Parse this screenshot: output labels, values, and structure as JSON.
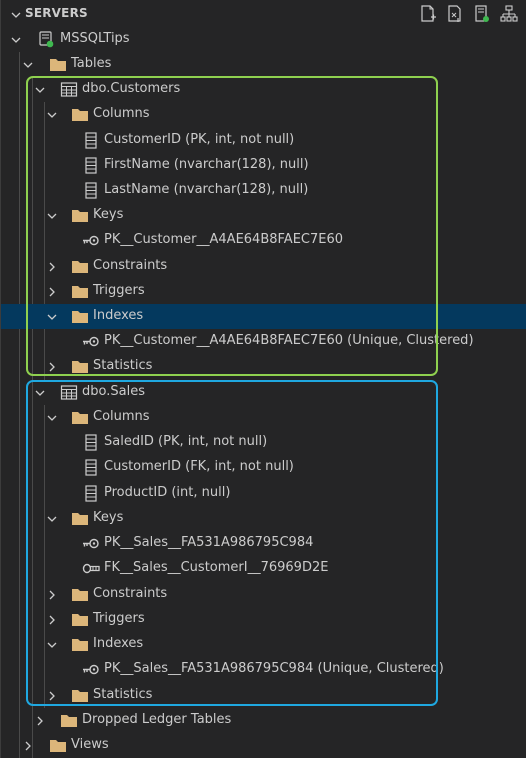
{
  "panel": {
    "title": "SERVERS",
    "toolbar": [
      "new-query-icon",
      "new-connection-icon",
      "new-server-group-icon",
      "active-connections-icon"
    ]
  },
  "tree": {
    "server": "MSSQLTips",
    "tables": "Tables",
    "customers": {
      "name": "dbo.Customers",
      "columns_label": "Columns",
      "columns": [
        "CustomerID (PK, int, not null)",
        "FirstName (nvarchar(128), null)",
        "LastName (nvarchar(128), null)"
      ],
      "keys_label": "Keys",
      "keys": [
        "PK__Customer__A4AE64B8FAEC7E60"
      ],
      "constraints_label": "Constraints",
      "triggers_label": "Triggers",
      "indexes_label": "Indexes",
      "indexes": [
        "PK__Customer__A4AE64B8FAEC7E60 (Unique, Clustered)"
      ],
      "statistics_label": "Statistics"
    },
    "sales": {
      "name": "dbo.Sales",
      "columns_label": "Columns",
      "columns": [
        "SaledID (PK, int, not null)",
        "CustomerID (FK, int, not null)",
        "ProductID (int, null)"
      ],
      "keys_label": "Keys",
      "keys": [
        "PK__Sales__FA531A986795C984",
        "FK__Sales__CustomerI__76969D2E"
      ],
      "constraints_label": "Constraints",
      "triggers_label": "Triggers",
      "indexes_label": "Indexes",
      "indexes": [
        "PK__Sales__FA531A986795C984 (Unique, Clustered)"
      ],
      "statistics_label": "Statistics"
    },
    "dropped_ledger": "Dropped Ledger Tables",
    "views": "Views"
  },
  "colors": {
    "background": "#252526",
    "selection": "#04395e",
    "green_box": "#8fd14f",
    "blue_box": "#1fa8e0",
    "folder": "#dcb67a",
    "connected": "#3fb950"
  }
}
